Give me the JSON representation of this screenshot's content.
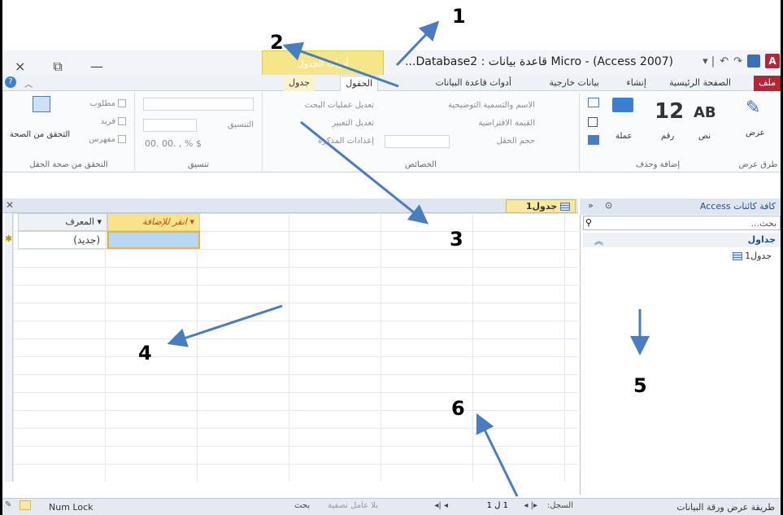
{
  "window": {
    "title": "Micro - (Access 2007) قاعدة بيانات : Database2...",
    "context_tab_group": "أدوات الجدول",
    "controls": [
      "×",
      "⧉",
      "—"
    ]
  },
  "tabs": [
    {
      "label": "ملف",
      "kind": "file"
    },
    {
      "label": "الصفحة الرئيسية",
      "kind": "normal"
    },
    {
      "label": "إنشاء",
      "kind": "normal"
    },
    {
      "label": "بيانات خارجية",
      "kind": "normal"
    },
    {
      "label": "أدوات قاعدة البيانات",
      "kind": "normal"
    },
    {
      "label": "الحقول",
      "kind": "active"
    },
    {
      "label": "جدول",
      "kind": "ctx"
    }
  ],
  "ribbon": {
    "views": {
      "label": "عرض",
      "group": "طرق عرض"
    },
    "add_delete": {
      "group": "إضافة وحذف",
      "text": "نص",
      "number": "رقم",
      "currency": "عملة",
      "big_ab": "AB",
      "big_12": "12"
    },
    "properties": {
      "group": "الخصائص",
      "name_caption": "الاسم والتسمية التوضيحية",
      "default_value": "القيمة الافتراضية",
      "field_size": "حجم الحقل",
      "modify_lookups": "تعديل عمليات البحث",
      "modify_expression": "تعديل التعبير",
      "memo_settings": "إعدادات المذكرة"
    },
    "formatting": {
      "group": "تنسيق",
      "format": "التنسيق",
      "symbols": "$  %  ,  .00 .00"
    },
    "validation": {
      "group": "التحقق من صحة الحقل",
      "required": "مطلوب",
      "unique": "فريد",
      "indexed": "مفهرس",
      "validation_btn": "التحقق من الصحة"
    }
  },
  "document": {
    "tab_label": "جدول1",
    "columns": {
      "id": "المعرف",
      "add": "انقر للإضافة"
    },
    "new_row": "(جديد)",
    "navbar": {
      "record": "السجل:",
      "position": "1 ل 1",
      "no_filter": "بلا عامل تصفية",
      "search": "بحث"
    }
  },
  "nav_pane": {
    "title": "كافة كائنات Access",
    "search_placeholder": "بحث...",
    "group": "جداول",
    "items": [
      "جدول1"
    ]
  },
  "status": {
    "left": "Num Lock",
    "right": "طريقة عرض ورقة البيانات"
  },
  "callouts": [
    "1",
    "2",
    "3",
    "4",
    "5",
    "6"
  ],
  "colors": {
    "arrow": "#4a7cc0",
    "file_tab": "#b5253a",
    "context": "#f7e38a"
  }
}
